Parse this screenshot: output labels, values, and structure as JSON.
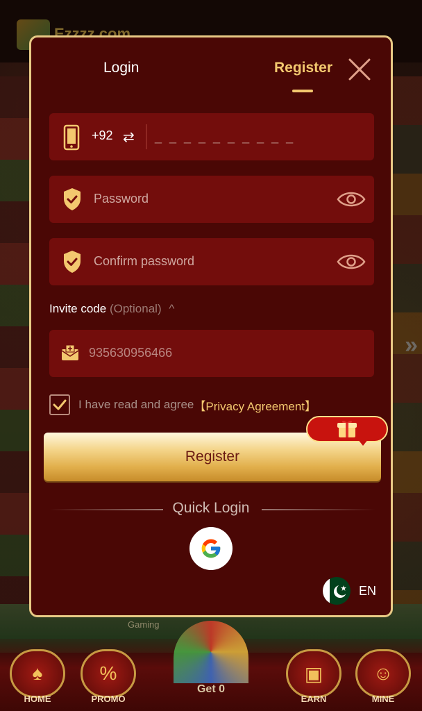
{
  "background": {
    "brand": "Ezzzz.com",
    "gaming_label": "Gaming",
    "bottom_nav": {
      "home": "HOME",
      "promo": "PROMO",
      "get": "Get 0",
      "earn": "EARN",
      "mine": "MINE"
    }
  },
  "modal": {
    "tabs": {
      "login": "Login",
      "register": "Register"
    },
    "phone": {
      "country_code": "+92",
      "placeholder": "_ _ _ _ _ _ _ _ _ _"
    },
    "password": {
      "placeholder": "Password"
    },
    "confirm_password": {
      "placeholder": "Confirm password"
    },
    "invite": {
      "label": "Invite code",
      "optional": "(Optional)",
      "value": "935630956466"
    },
    "agreement": {
      "text": "I have read and agree",
      "link": "【Privacy Agreement】",
      "checked": true
    },
    "register_button": "Register",
    "quick_login": "Quick Login",
    "language": "EN"
  },
  "colors": {
    "modal_bg": "#4a0705",
    "field_bg": "#730d0c",
    "accent_gold": "#f3c86f",
    "border": "#e8c985"
  },
  "icons": [
    "close-icon",
    "phone-icon",
    "swap-icon",
    "shield-icon",
    "eye-icon",
    "envelope-icon",
    "check-icon",
    "gift-icon",
    "google-icon",
    "pakistan-flag-icon"
  ]
}
